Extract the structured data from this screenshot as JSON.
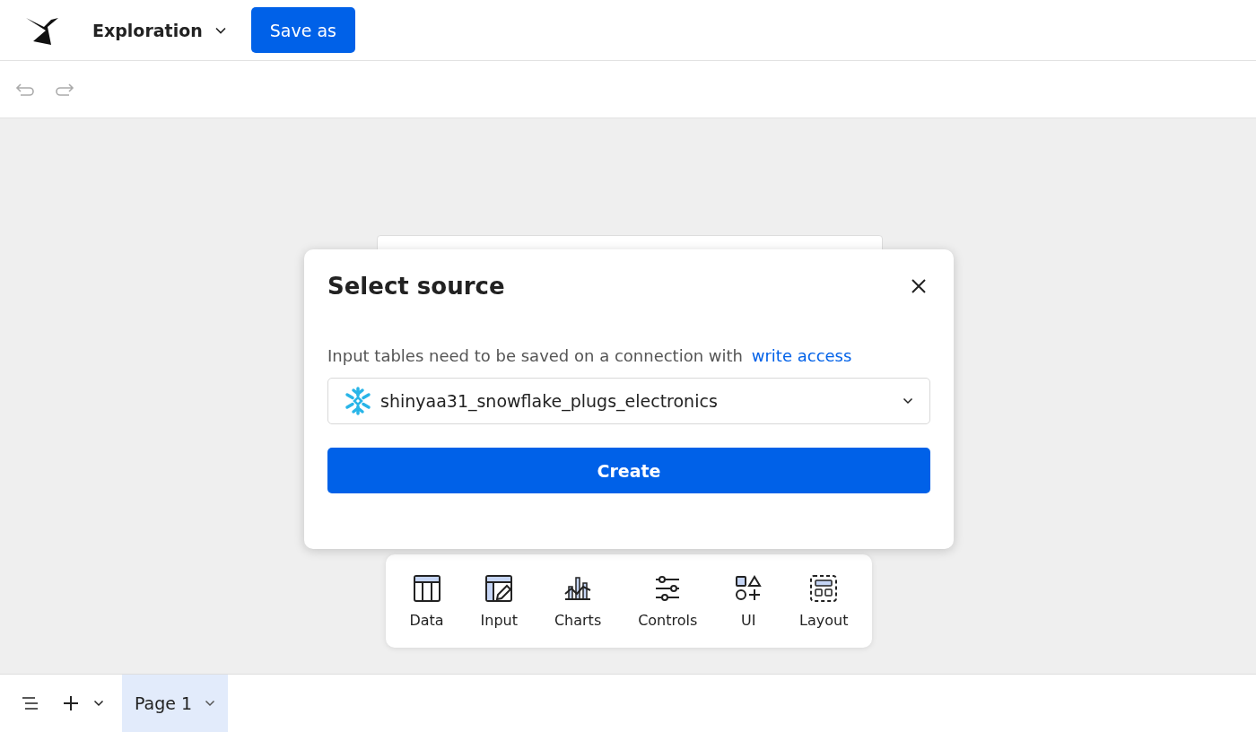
{
  "header": {
    "title": "Exploration",
    "save_button": "Save as"
  },
  "dialog": {
    "title": "Select source",
    "message": "Input tables need to be saved on a connection with",
    "link": "write access",
    "connection": "shinyaa31_snowflake_plugs_electronics",
    "create_button": "Create"
  },
  "toolbar": [
    {
      "kind": "data",
      "label": "Data"
    },
    {
      "kind": "input",
      "label": "Input"
    },
    {
      "kind": "charts",
      "label": "Charts"
    },
    {
      "kind": "controls",
      "label": "Controls"
    },
    {
      "kind": "ui",
      "label": "UI"
    },
    {
      "kind": "layout",
      "label": "Layout"
    }
  ],
  "pages": [
    {
      "label": "Page 1",
      "selected": true
    }
  ]
}
